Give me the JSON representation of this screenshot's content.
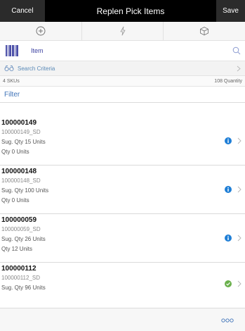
{
  "header": {
    "title": "Replen Pick Items",
    "cancel_label": "Cancel",
    "save_label": "Save"
  },
  "actions": [
    {
      "icon": "add-circle-icon"
    },
    {
      "icon": "lightning-icon"
    },
    {
      "icon": "cube-icon"
    }
  ],
  "item_input": {
    "label": "Item",
    "icon": "barcode-icon"
  },
  "search_criteria": {
    "label": "Search Criteria"
  },
  "summary": {
    "sku_count": "4 SKUs",
    "quantity": "108 Quantity"
  },
  "filter": {
    "label": "Filter"
  },
  "items": [
    {
      "id": "100000149",
      "sub": "100000149_SD",
      "sug": "Sug. Qty  15  Units",
      "qty": "Qty  0  Units",
      "status_icon": "info-icon",
      "status_color": "#1e7ed6"
    },
    {
      "id": "100000148",
      "sub": "100000148_SD",
      "sug": "Sug. Qty  100  Units",
      "qty": "Qty  0  Units",
      "status_icon": "info-icon",
      "status_color": "#1e7ed6"
    },
    {
      "id": "100000059",
      "sub": "100000059_SD",
      "sug": "Sug. Qty  26  Units",
      "qty": "Qty  12  Units",
      "status_icon": "info-icon",
      "status_color": "#1e7ed6"
    },
    {
      "id": "100000112",
      "sub": "100000112_SD",
      "sug": "Sug. Qty  96  Units",
      "qty": "",
      "status_icon": "check-icon",
      "status_color": "#6ab04c"
    }
  ],
  "colors": {
    "accent": "#3f73b8",
    "brand_dark": "#000000"
  }
}
